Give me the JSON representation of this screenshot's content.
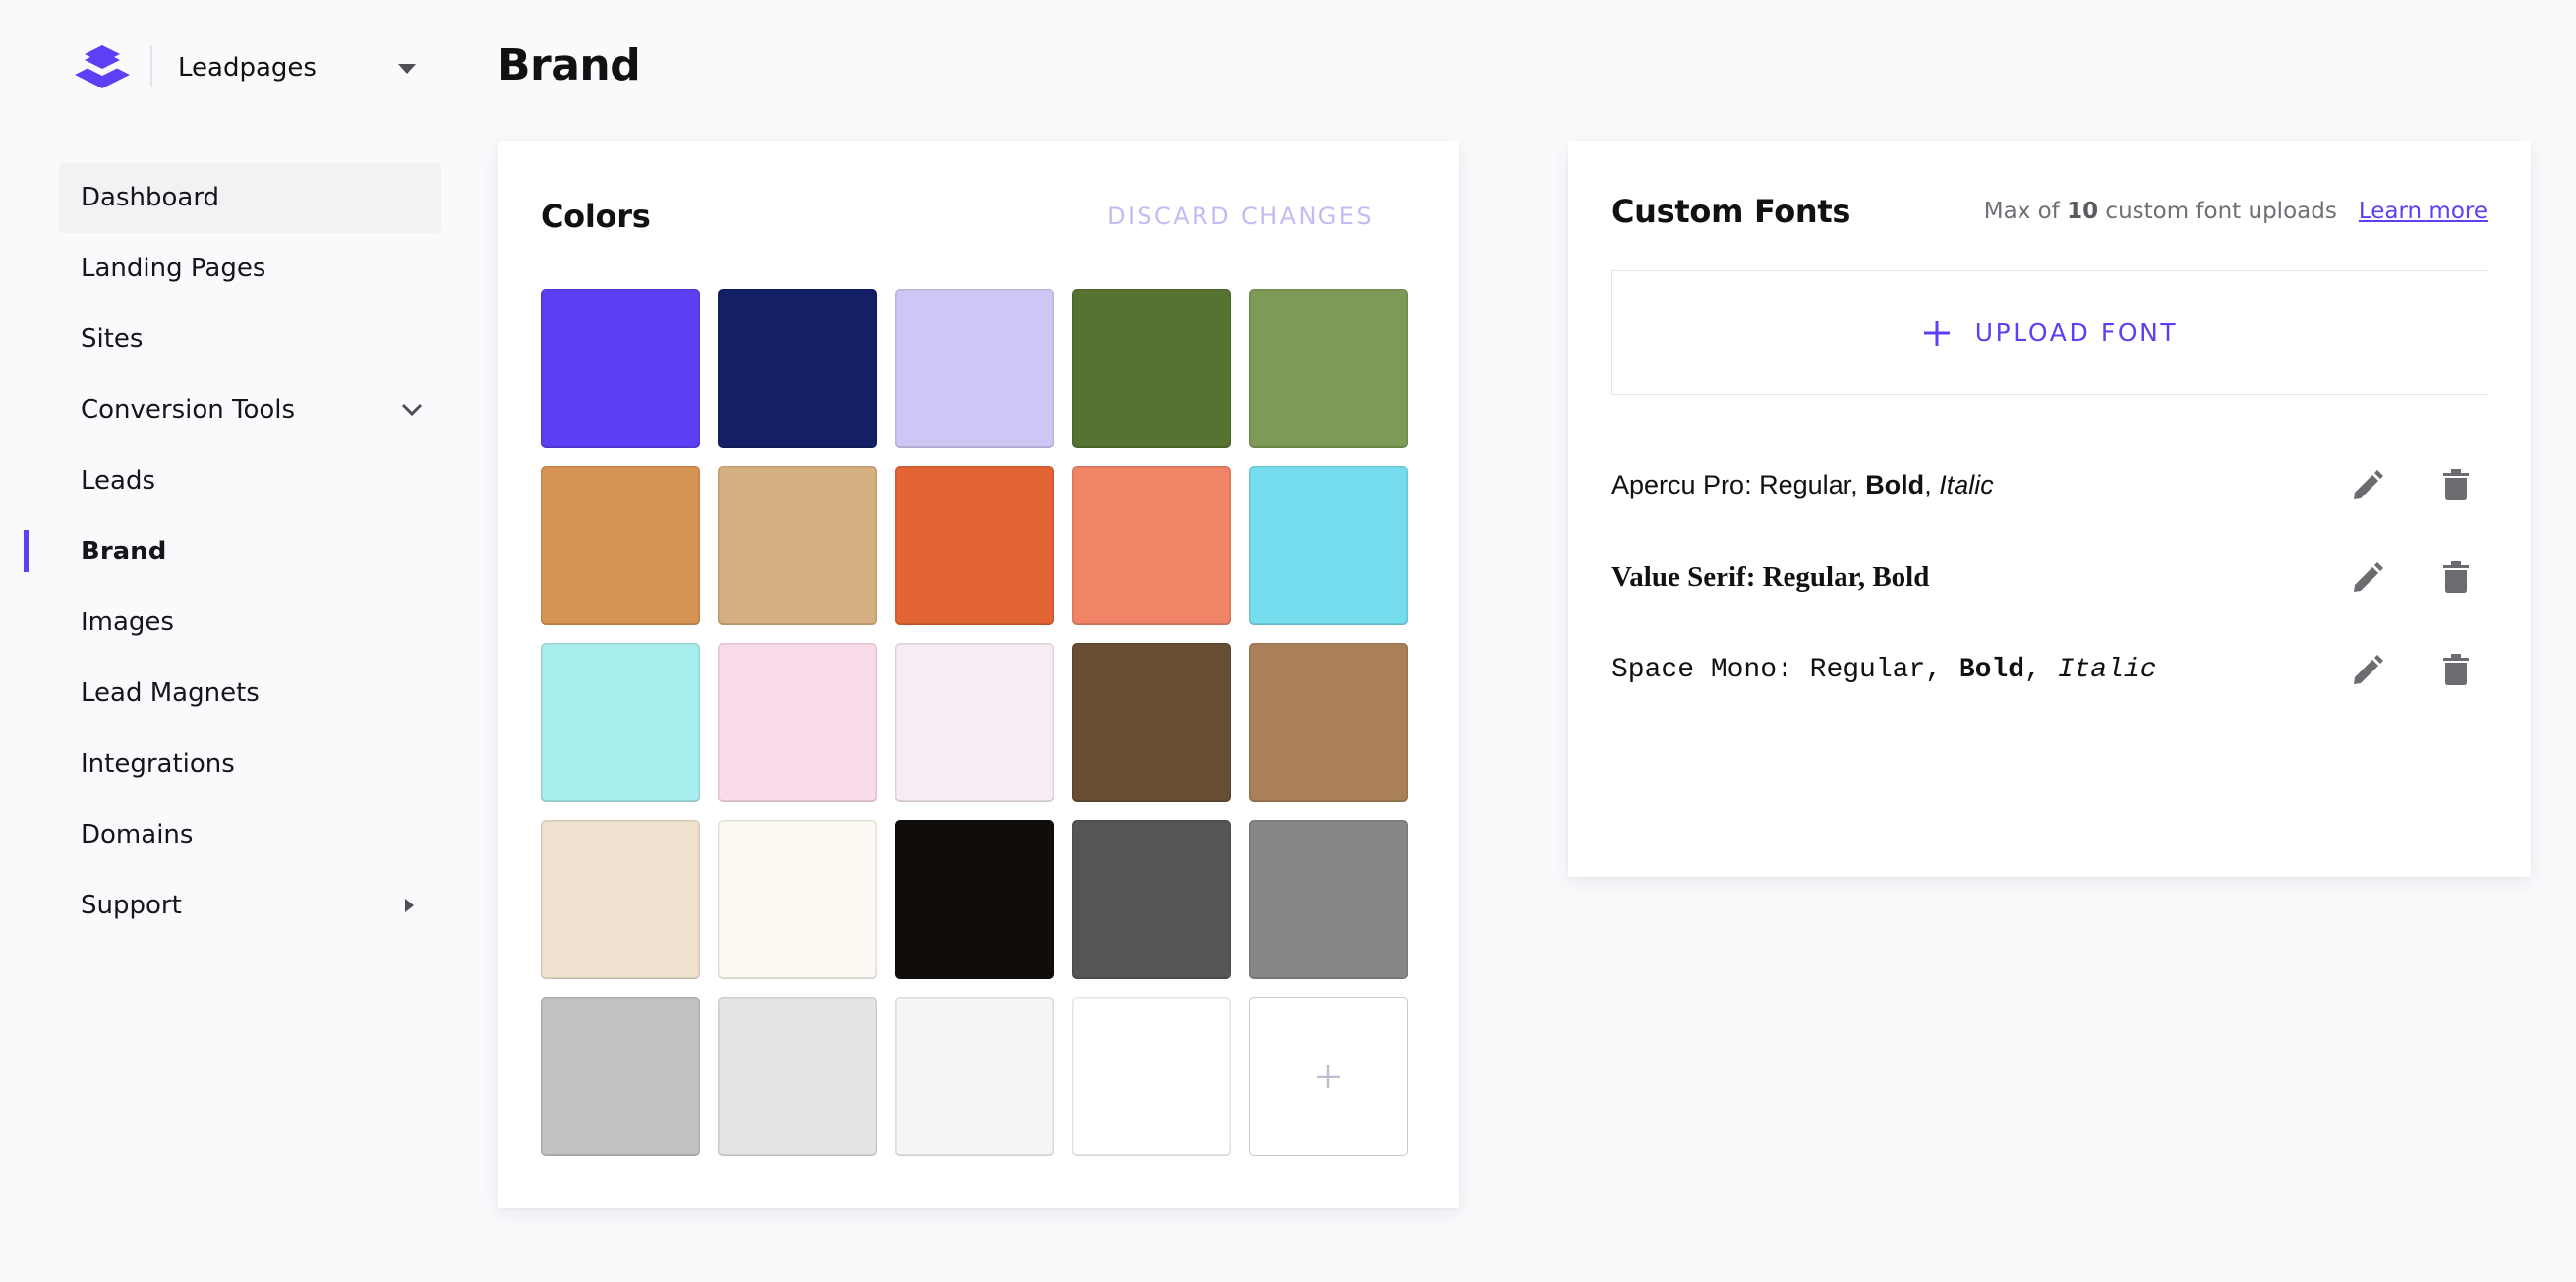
{
  "app": {
    "workspace": "Leadpages",
    "logo_icon": "layers-logo-icon",
    "accent_color": "#5b40f4"
  },
  "sidebar": {
    "items": [
      {
        "label": "Dashboard",
        "state": "hover"
      },
      {
        "label": "Landing Pages"
      },
      {
        "label": "Sites"
      },
      {
        "label": "Conversion Tools",
        "icon": "chevron-down-icon"
      },
      {
        "label": "Leads"
      },
      {
        "label": "Brand",
        "state": "active"
      },
      {
        "label": "Images"
      },
      {
        "label": "Lead Magnets"
      },
      {
        "label": "Integrations"
      },
      {
        "label": "Domains"
      },
      {
        "label": "Support",
        "icon": "caret-right-icon"
      }
    ]
  },
  "page": {
    "title": "Brand"
  },
  "colors": {
    "title": "Colors",
    "discard_label": "DISCARD CHANGES",
    "add_icon": "plus-icon",
    "swatches": [
      "#5b3ff3",
      "#132066",
      "#d0c6f5",
      "#567331",
      "#7e9a57",
      "#d69354",
      "#d5af80",
      "#e36435",
      "#ef8566",
      "#75dded",
      "#a8eeec",
      "#f9dcea",
      "#f7ecf4",
      "#684f33",
      "#a98058",
      "#efe3cf",
      "#fcf8f2",
      "#110d0a",
      "#575654",
      "#888785",
      "#c3c2c0",
      "#e4e4e4",
      "#f5f5f5",
      "#ffffff"
    ]
  },
  "fonts": {
    "title": "Custom Fonts",
    "limit_prefix": "Max of ",
    "limit_count": "10",
    "limit_suffix": " custom font uploads",
    "learn_more": "Learn more",
    "upload_label": "UPLOAD FONT",
    "items": [
      {
        "name": "Apercu Pro",
        "styles": [
          "Regular",
          "Bold",
          "Italic"
        ]
      },
      {
        "name": "Value Serif",
        "styles": [
          "Regular",
          "Bold"
        ]
      },
      {
        "name": "Space Mono",
        "styles": [
          "Regular",
          "Bold",
          "Italic"
        ]
      }
    ],
    "row_actions": [
      "pencil-icon",
      "trash-icon"
    ]
  }
}
